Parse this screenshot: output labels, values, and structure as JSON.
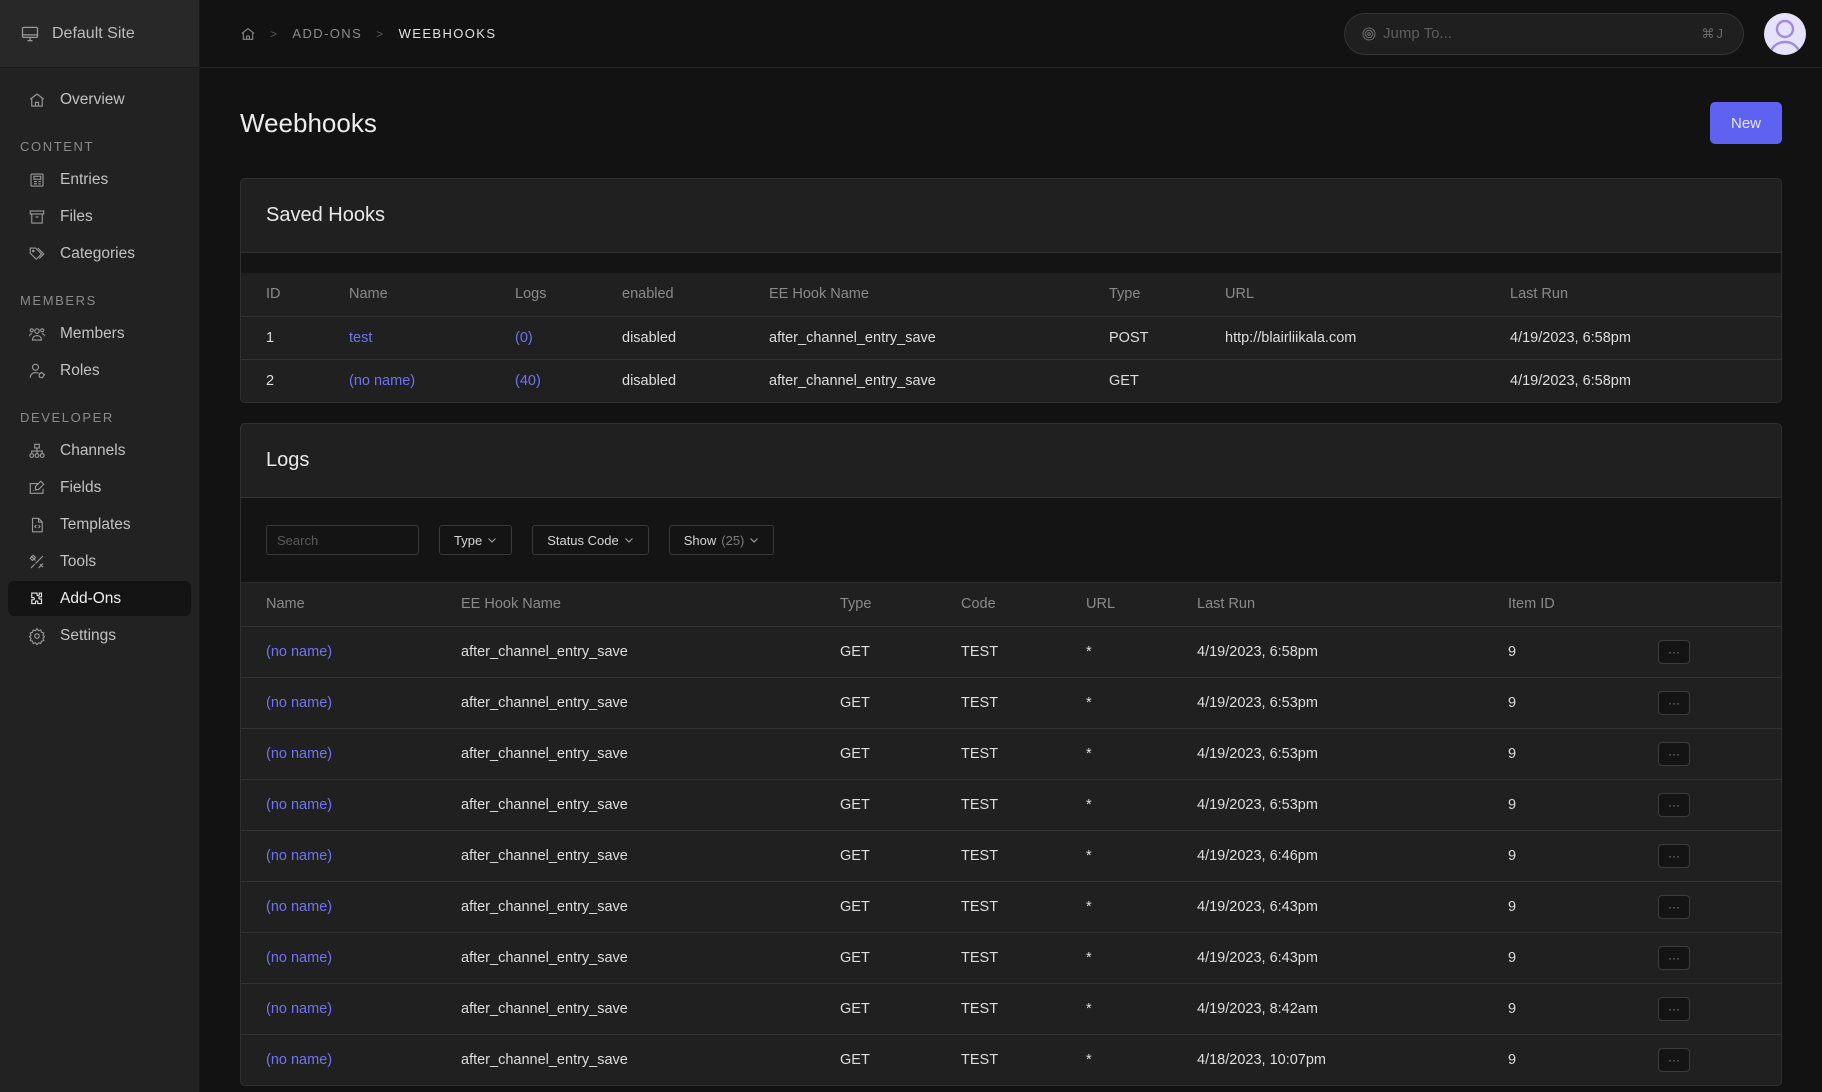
{
  "sidebar": {
    "site_name": "Default Site",
    "items_top": [
      {
        "label": "Overview",
        "icon": "home-icon"
      }
    ],
    "groups": [
      {
        "title": "CONTENT",
        "items": [
          {
            "label": "Entries",
            "icon": "newspaper-icon"
          },
          {
            "label": "Files",
            "icon": "archive-box-icon"
          },
          {
            "label": "Categories",
            "icon": "tags-icon"
          }
        ]
      },
      {
        "title": "MEMBERS",
        "items": [
          {
            "label": "Members",
            "icon": "users-icon"
          },
          {
            "label": "Roles",
            "icon": "user-tag-icon"
          }
        ]
      },
      {
        "title": "DEVELOPER",
        "items": [
          {
            "label": "Channels",
            "icon": "sitemap-icon"
          },
          {
            "label": "Fields",
            "icon": "edit-field-icon"
          },
          {
            "label": "Templates",
            "icon": "file-code-icon"
          },
          {
            "label": "Tools",
            "icon": "tools-icon"
          },
          {
            "label": "Add-Ons",
            "icon": "puzzle-icon",
            "active": true
          },
          {
            "label": "Settings",
            "icon": "gear-icon"
          }
        ]
      }
    ]
  },
  "topbar": {
    "breadcrumb": [
      "ADD-ONS",
      "WEEBHOOKS"
    ],
    "breadcrumb_sep": ">",
    "jump_placeholder": "Jump To...",
    "jump_shortcut": "⌘J"
  },
  "page": {
    "title": "Weebhooks",
    "new_button": "New"
  },
  "saved_hooks": {
    "title": "Saved Hooks",
    "columns": [
      "ID",
      "Name",
      "Logs",
      "enabled",
      "EE Hook Name",
      "Type",
      "URL",
      "Last Run"
    ],
    "rows": [
      {
        "id": "1",
        "name": "test",
        "logs": "(0)",
        "enabled": "disabled",
        "hook": "after_channel_entry_save",
        "type": "POST",
        "url": "http://blairliikala.com",
        "last_run": "4/19/2023, 6:58pm"
      },
      {
        "id": "2",
        "name": "(no name)",
        "logs": "(40)",
        "enabled": "disabled",
        "hook": "after_channel_entry_save",
        "type": "GET",
        "url": "",
        "last_run": "4/19/2023, 6:58pm"
      }
    ]
  },
  "logs": {
    "title": "Logs",
    "search_placeholder": "Search",
    "filters": {
      "type": "Type",
      "status_code": "Status Code",
      "show": "Show",
      "show_count": "(25)"
    },
    "columns": [
      "Name",
      "EE Hook Name",
      "Type",
      "Code",
      "URL",
      "Last Run",
      "Item ID",
      ""
    ],
    "actions_label": "···",
    "rows": [
      {
        "name": "(no name)",
        "hook": "after_channel_entry_save",
        "type": "GET",
        "code": "TEST",
        "url": "*",
        "last_run": "4/19/2023, 6:58pm",
        "item_id": "9"
      },
      {
        "name": "(no name)",
        "hook": "after_channel_entry_save",
        "type": "GET",
        "code": "TEST",
        "url": "*",
        "last_run": "4/19/2023, 6:53pm",
        "item_id": "9"
      },
      {
        "name": "(no name)",
        "hook": "after_channel_entry_save",
        "type": "GET",
        "code": "TEST",
        "url": "*",
        "last_run": "4/19/2023, 6:53pm",
        "item_id": "9"
      },
      {
        "name": "(no name)",
        "hook": "after_channel_entry_save",
        "type": "GET",
        "code": "TEST",
        "url": "*",
        "last_run": "4/19/2023, 6:53pm",
        "item_id": "9"
      },
      {
        "name": "(no name)",
        "hook": "after_channel_entry_save",
        "type": "GET",
        "code": "TEST",
        "url": "*",
        "last_run": "4/19/2023, 6:46pm",
        "item_id": "9"
      },
      {
        "name": "(no name)",
        "hook": "after_channel_entry_save",
        "type": "GET",
        "code": "TEST",
        "url": "*",
        "last_run": "4/19/2023, 6:43pm",
        "item_id": "9"
      },
      {
        "name": "(no name)",
        "hook": "after_channel_entry_save",
        "type": "GET",
        "code": "TEST",
        "url": "*",
        "last_run": "4/19/2023, 6:43pm",
        "item_id": "9"
      },
      {
        "name": "(no name)",
        "hook": "after_channel_entry_save",
        "type": "GET",
        "code": "TEST",
        "url": "*",
        "last_run": "4/19/2023, 8:42am",
        "item_id": "9"
      },
      {
        "name": "(no name)",
        "hook": "after_channel_entry_save",
        "type": "GET",
        "code": "TEST",
        "url": "*",
        "last_run": "4/18/2023, 10:07pm",
        "item_id": "9"
      }
    ]
  },
  "colors": {
    "accent": "#5d63f0",
    "link": "#6f74f2",
    "sidebar_bg": "#222222",
    "main_bg": "#121212",
    "panel_bg": "#202020"
  }
}
